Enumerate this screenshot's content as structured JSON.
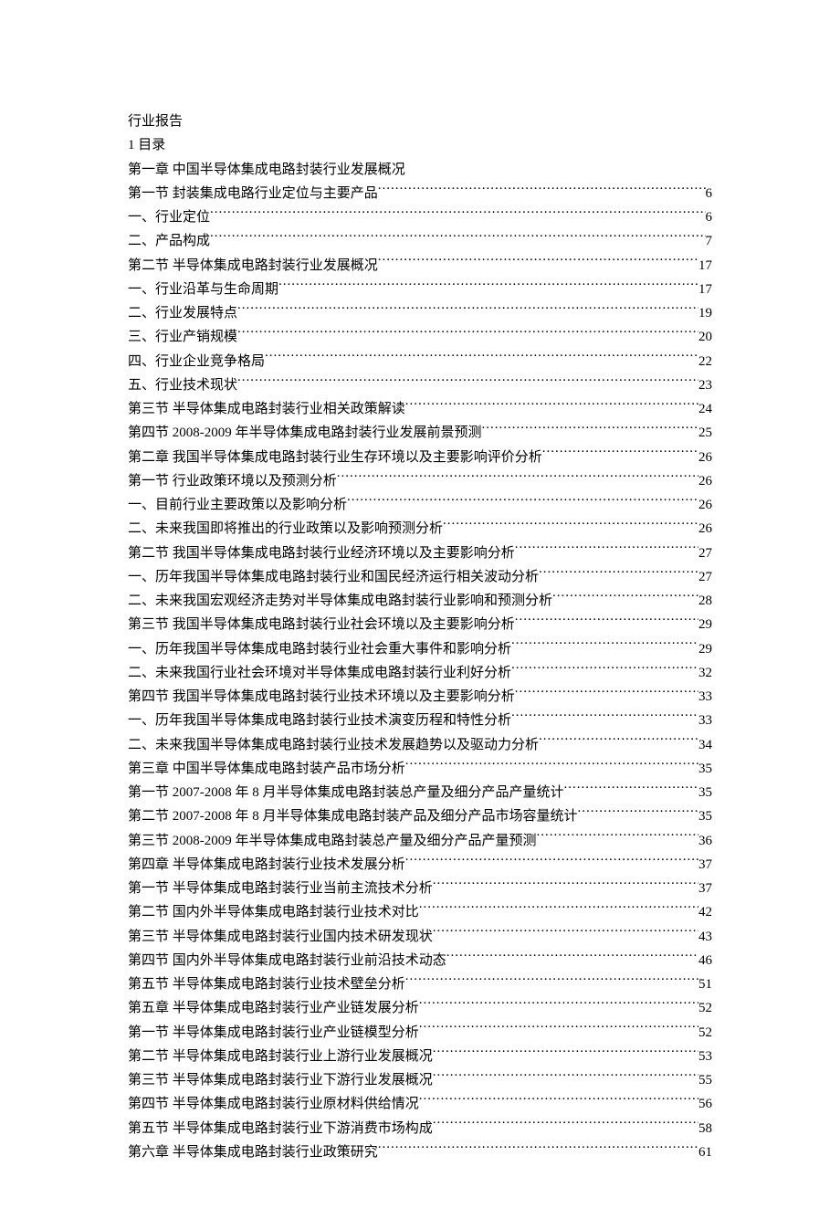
{
  "header": {
    "title": "行业报告",
    "toc_label": "1 目录",
    "chapter1_heading": "第一章 中国半导体集成电路封装行业发展概况"
  },
  "toc": [
    {
      "label": "第一节 封装集成电路行业定位与主要产品",
      "page": "6"
    },
    {
      "label": "一、行业定位",
      "page": "6"
    },
    {
      "label": "二、产品构成",
      "page": "7"
    },
    {
      "label": "第二节 半导体集成电路封装行业发展概况",
      "page": "17"
    },
    {
      "label": "一、行业沿革与生命周期",
      "page": "17"
    },
    {
      "label": "二、行业发展特点",
      "page": "19"
    },
    {
      "label": "三、行业产销规模",
      "page": "20"
    },
    {
      "label": "四、行业企业竞争格局",
      "page": "22"
    },
    {
      "label": "五、行业技术现状",
      "page": "23"
    },
    {
      "label": "第三节 半导体集成电路封装行业相关政策解读",
      "page": "24"
    },
    {
      "label": "第四节 2008-2009 年半导体集成电路封装行业发展前景预测",
      "page": "25"
    },
    {
      "label": "第二章 我国半导体集成电路封装行业生存环境以及主要影响评价分析",
      "page": "26"
    },
    {
      "label": "第一节 行业政策环境以及预测分析",
      "page": "26"
    },
    {
      "label": "一、目前行业主要政策以及影响分析",
      "page": "26"
    },
    {
      "label": "二、未来我国即将推出的行业政策以及影响预测分析",
      "page": "26"
    },
    {
      "label": "第二节 我国半导体集成电路封装行业经济环境以及主要影响分析",
      "page": "27"
    },
    {
      "label": "一、历年我国半导体集成电路封装行业和国民经济运行相关波动分析",
      "page": "27"
    },
    {
      "label": "二、未来我国宏观经济走势对半导体集成电路封装行业影响和预测分析",
      "page": "28"
    },
    {
      "label": "第三节 我国半导体集成电路封装行业社会环境以及主要影响分析",
      "page": "29"
    },
    {
      "label": "一、历年我国半导体集成电路封装行业社会重大事件和影响分析",
      "page": "29"
    },
    {
      "label": "二、未来我国行业社会环境对半导体集成电路封装行业利好分析",
      "page": "32"
    },
    {
      "label": "第四节 我国半导体集成电路封装行业技术环境以及主要影响分析",
      "page": "33"
    },
    {
      "label": "一、历年我国半导体集成电路封装行业技术演变历程和特性分析",
      "page": "33"
    },
    {
      "label": "二、未来我国半导体集成电路封装行业技术发展趋势以及驱动力分析",
      "page": "34"
    },
    {
      "label": "第三章 中国半导体集成电路封装产品市场分析",
      "page": "35"
    },
    {
      "label": "第一节 2007-2008 年 8 月半导体集成电路封装总产量及细分产品产量统计",
      "page": "35"
    },
    {
      "label": "第二节 2007-2008 年 8 月半导体集成电路封装产品及细分产品市场容量统计",
      "page": "35"
    },
    {
      "label": "第三节 2008-2009 年半导体集成电路封装总产量及细分产品产量预测",
      "page": "36"
    },
    {
      "label": "第四章 半导体集成电路封装行业技术发展分析",
      "page": "37"
    },
    {
      "label": "第一节 半导体集成电路封装行业当前主流技术分析",
      "page": "37"
    },
    {
      "label": "第二节 国内外半导体集成电路封装行业技术对比",
      "page": "42"
    },
    {
      "label": "第三节 半导体集成电路封装行业国内技术研发现状",
      "page": "43"
    },
    {
      "label": "第四节 国内外半导体集成电路封装行业前沿技术动态",
      "page": "46"
    },
    {
      "label": "第五节 半导体集成电路封装行业技术壁垒分析",
      "page": "51"
    },
    {
      "label": "第五章 半导体集成电路封装行业产业链发展分析",
      "page": "52"
    },
    {
      "label": "第一节 半导体集成电路封装行业产业链模型分析",
      "page": "52"
    },
    {
      "label": "第二节 半导体集成电路封装行业上游行业发展概况",
      "page": "53"
    },
    {
      "label": "第三节 半导体集成电路封装行业下游行业发展概况",
      "page": "55"
    },
    {
      "label": "第四节 半导体集成电路封装行业原材料供给情况",
      "page": "56"
    },
    {
      "label": "第五节 半导体集成电路封装行业下游消费市场构成",
      "page": "58"
    },
    {
      "label": "第六章 半导体集成电路封装行业政策研究",
      "page": "61"
    }
  ]
}
